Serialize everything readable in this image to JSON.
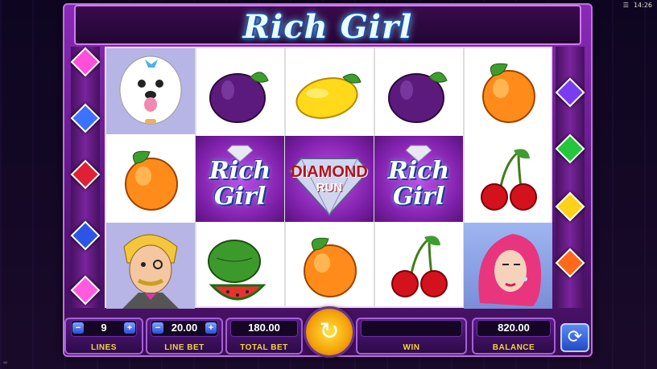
{
  "status_bar": {
    "menu_icon": "hamburger-icon",
    "time": "14:26"
  },
  "game": {
    "title": "Rich Girl"
  },
  "reels": {
    "rows": [
      [
        "Dog",
        "Plum",
        "Lemon",
        "Plum",
        "Peach"
      ],
      [
        "Peach",
        "Rich Girl",
        "Diamond Run",
        "Rich Girl",
        "Cherries"
      ],
      [
        "Butler",
        "Watermelon",
        "Peach",
        "Cherries",
        "Rich Girl Lady"
      ]
    ],
    "symbol_text": {
      "rich": "Rich",
      "girl": "Girl",
      "diamond": "DIAMOND",
      "run": "RUN"
    }
  },
  "controls": {
    "lines": {
      "value": "9",
      "label": "LINES"
    },
    "line_bet": {
      "value": "20.00",
      "label": "LINE BET"
    },
    "total_bet": {
      "value": "180.00",
      "label": "TOTAL BET"
    },
    "win": {
      "value": "",
      "label": "WIN"
    },
    "balance": {
      "value": "820.00",
      "label": "BALANCE"
    },
    "minus": "−",
    "plus": "+",
    "spin_icon": "↻",
    "autoplay_icon": "⟳"
  },
  "colors": {
    "frame": "#7a249e",
    "accent": "#f4d43a",
    "title": "#eafcff"
  },
  "corner_mark": "∞"
}
